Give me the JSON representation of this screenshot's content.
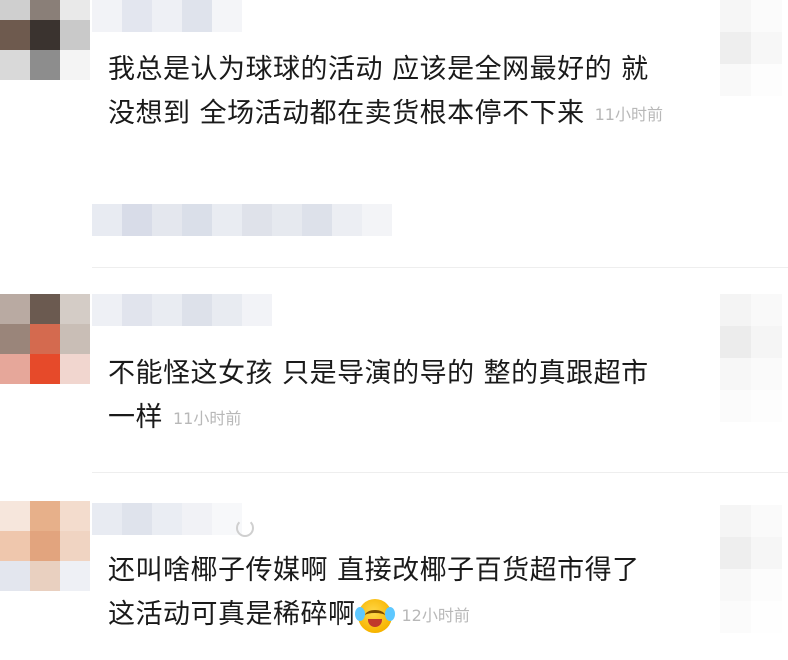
{
  "colors": {
    "text": "#1a1a1a",
    "time": "#b8b8b8",
    "divider": "#eeeeee"
  },
  "comments": [
    {
      "text_line1": "我总是认为球球的活动 应该是全网最好的  就",
      "text_line2": "没想到 全场活动都在卖货根本停不下来",
      "time": "11小时前",
      "avatar_icon": "avatar-pixelated",
      "like_icon": "like-pixelated"
    },
    {
      "text_line1": "不能怪这女孩 只是导演的导的 整的真跟超市",
      "text_line2": "一样",
      "time": "11小时前",
      "avatar_icon": "avatar-pixelated",
      "like_icon": "like-pixelated"
    },
    {
      "text_line1": "还叫啥椰子传媒啊 直接改椰子百货超市得了",
      "text_line2": "这活动可真是稀碎啊",
      "emoji": "laughing-crying-emoji",
      "time": "12小时前",
      "avatar_icon": "avatar-pixelated",
      "like_icon": "like-pixelated"
    }
  ]
}
